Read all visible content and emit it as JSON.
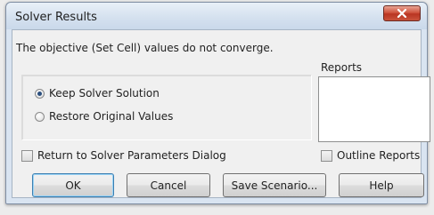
{
  "window": {
    "title": "Solver Results",
    "close_glyph": "✕"
  },
  "message": "The objective (Set Cell) values do not converge.",
  "options": {
    "keep_label": "Keep Solver Solution",
    "keep_checked": true,
    "restore_label": "Restore Original Values",
    "restore_checked": false
  },
  "reports": {
    "label": "Reports",
    "items": []
  },
  "checkboxes": {
    "return_label": "Return to Solver Parameters Dialog",
    "return_checked": false,
    "outline_label": "Outline Reports",
    "outline_checked": false
  },
  "buttons": {
    "ok": "OK",
    "cancel": "Cancel",
    "save_scenario": "Save Scenario...",
    "help": "Help"
  },
  "colors": {
    "close_button": "#c9442f",
    "default_button_border": "#3c7fb1"
  }
}
